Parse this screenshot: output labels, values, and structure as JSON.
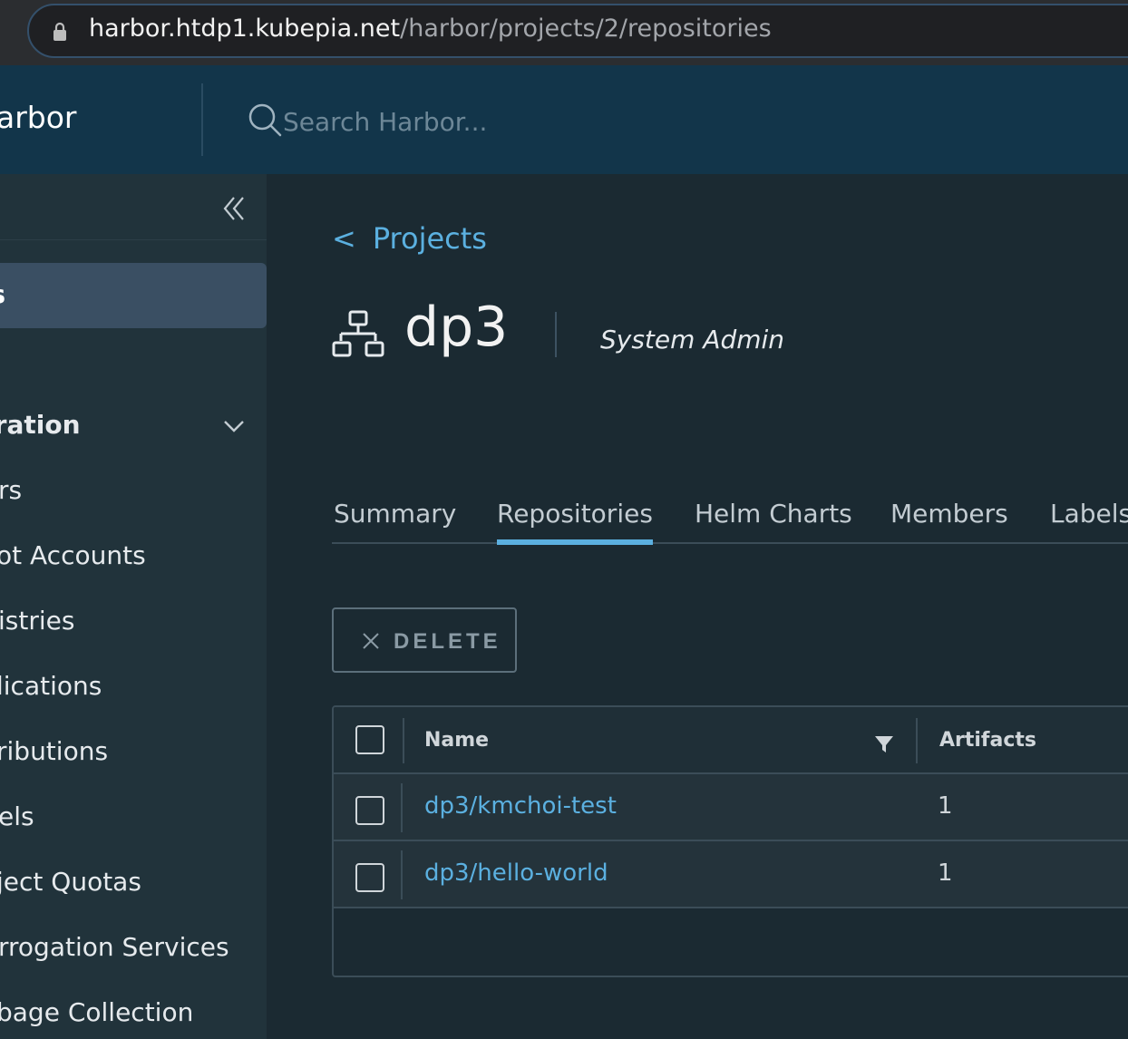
{
  "browser": {
    "url_host": "harbor.htdp1.kubepia.net",
    "url_path": "/harbor/projects/2/repositories"
  },
  "header": {
    "brand": "arbor",
    "search_placeholder": "Search Harbor..."
  },
  "sidebar": {
    "active_item": "ts",
    "group_label": "istration",
    "items": [
      {
        "label": "rs"
      },
      {
        "label": "ot Accounts"
      },
      {
        "label": "istries"
      },
      {
        "label": "lications"
      },
      {
        "label": "ributions"
      },
      {
        "label": "els"
      },
      {
        "label": "ject Quotas"
      },
      {
        "label": "rrogation Services"
      },
      {
        "label": "bage Collection"
      }
    ]
  },
  "main": {
    "back_link": "Projects",
    "project_name": "dp3",
    "role": "System Admin",
    "tabs": [
      {
        "label": "Summary",
        "active": false
      },
      {
        "label": "Repositories",
        "active": true
      },
      {
        "label": "Helm Charts",
        "active": false
      },
      {
        "label": "Members",
        "active": false
      },
      {
        "label": "Labels",
        "active": false
      }
    ],
    "delete_label": "DELETE",
    "grid": {
      "columns": [
        "Name",
        "Artifacts"
      ],
      "rows": [
        {
          "name": "dp3/kmchoi-test",
          "artifacts": "1"
        },
        {
          "name": "dp3/hello-world",
          "artifacts": "1"
        }
      ]
    }
  },
  "colors": {
    "header_bg": "#12354a",
    "sidebar_bg": "#21333b",
    "main_bg": "#1b2a32",
    "accent": "#5bb0e0"
  }
}
